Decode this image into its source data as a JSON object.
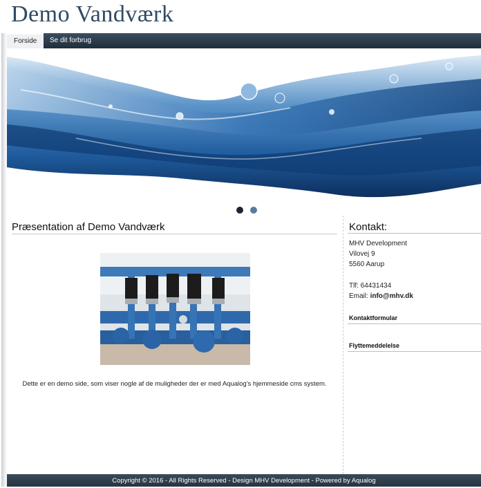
{
  "site": {
    "title": "Demo Vandværk"
  },
  "nav": {
    "items": [
      {
        "label": "Forside"
      },
      {
        "label": "Se dit forbrug"
      }
    ]
  },
  "colors": {
    "nav_bg": "#1f2d3b",
    "title": "#2f4a63",
    "dot_active": "#1b2633",
    "dot_inactive": "#5b7c99"
  },
  "main": {
    "heading": "Præsentation af Demo Vandværk",
    "intro": "Dette er en demo side, som viser nogle af de muligheder der er med Aqualog's hjemmeside cms system."
  },
  "sidebar": {
    "heading": "Kontakt:",
    "company": "MHV Development",
    "street": "Vilovej 9",
    "city": "5560 Aarup",
    "phone": "Tlf: 64431434",
    "email_label": "Email: ",
    "email": "info@mhv.dk",
    "contact_form": "Kontaktformular",
    "moving_notice": "Flyttemeddelelse"
  },
  "footer": {
    "text": "Copyright © 2016 - All Rights Reserved - Design MHV Development - Powered by Aqualog"
  }
}
